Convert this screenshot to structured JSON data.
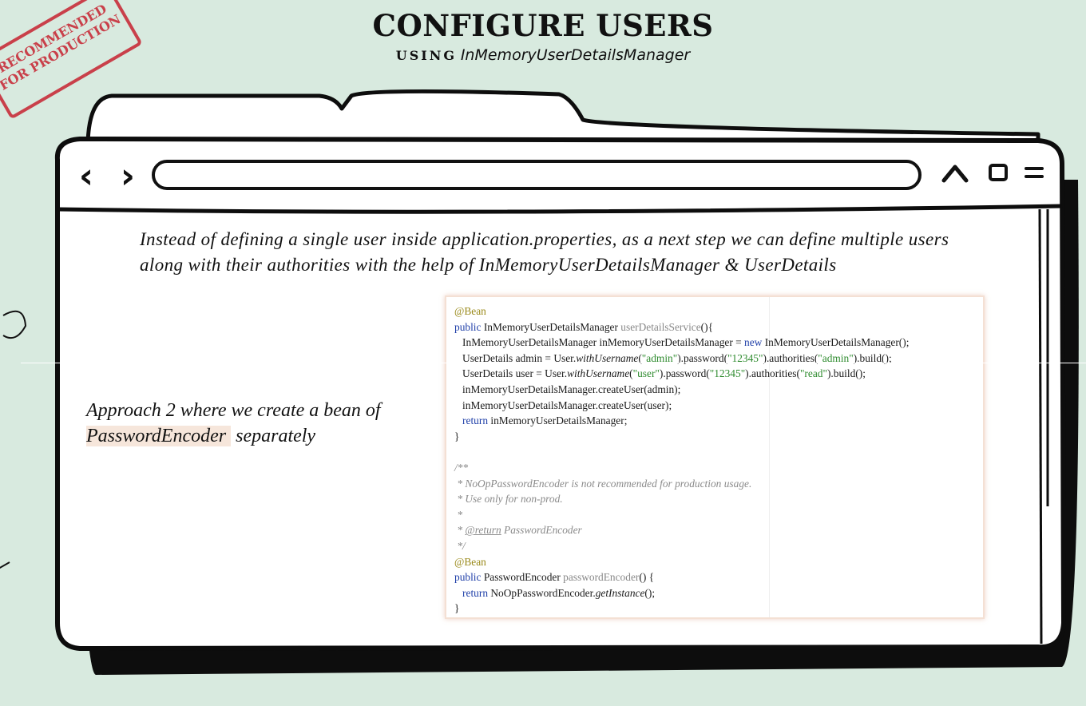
{
  "heading": {
    "title": "CONFIGURE USERS",
    "subtitle_prefix": "USING",
    "subtitle_class": "InMemoryUserDetailsManager"
  },
  "stamp": {
    "line1": "RECOMMENDED",
    "line2": "FOR PRODUCTION"
  },
  "browser": {
    "back_icon": "chevron-left",
    "forward_icon": "chevron-right",
    "minimize_icon": "chevron-up",
    "maximize_icon": "square",
    "menu_icon": "two-bars"
  },
  "content": {
    "intro": "Instead of  defining a single user inside application.properties, as a next step we can define multiple users along with their authorities with the help of  InMemoryUserDetailsManager & UserDetails",
    "approach_prefix": "Approach 2 where we create a bean of",
    "approach_highlight": "PasswordEncoder",
    "approach_suffix": " separately"
  },
  "code": {
    "ann_bean": "@Bean",
    "kw_public": "public",
    "kw_new": "new",
    "kw_return": "return",
    "type_manager": "InMemoryUserDetailsManager",
    "method_uds": "userDetailsService",
    "open_sig": "(){",
    "var_decl": "InMemoryUserDetailsManager inMemoryUserDetailsManager = ",
    "ctor_call": "InMemoryUserDetailsManager();",
    "admin_decl": "UserDetails admin = User.",
    "with_username": "withUsername",
    "str_admin": "\"admin\"",
    "password_call": ").password(",
    "str_12345": "\"12345\"",
    "authorities_call": ").authorities(",
    "build_call": ").build();",
    "user_decl": "UserDetails user = User.",
    "str_user": "\"user\"",
    "str_read": "\"read\"",
    "create_admin": "inMemoryUserDetailsManager.createUser(admin);",
    "create_user": "inMemoryUserDetailsManager.createUser(user);",
    "return_var": " inMemoryUserDetailsManager;",
    "close_brace": "}",
    "cm_open": "/**",
    "cm_line1": " * NoOpPasswordEncoder is not recommended for production usage.",
    "cm_line2": " * Use only for non-prod.",
    "cm_line3": " *",
    "cm_line4_prefix": " * ",
    "cm_return_tag": "@return",
    "cm_line4_suffix": " PasswordEncoder",
    "cm_close": " */",
    "type_encoder": "PasswordEncoder",
    "method_pe": "passwordEncoder",
    "open_sig2": "() {",
    "noop_class": "NoOpPasswordEncoder.",
    "get_instance": "getInstance",
    "paren_end": "();"
  }
}
